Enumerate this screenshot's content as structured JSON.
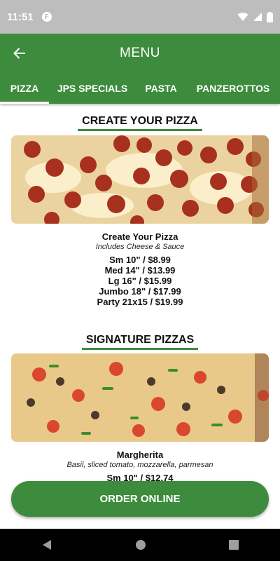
{
  "status": {
    "time": "11:51"
  },
  "header": {
    "title": "MENU"
  },
  "tabs": [
    {
      "label": "PIZZA"
    },
    {
      "label": "JPS SPECIALS"
    },
    {
      "label": "PASTA"
    },
    {
      "label": "PANZEROTTOS"
    }
  ],
  "sections": [
    {
      "title": "CREATE YOUR PIZZA",
      "item": {
        "name": "Create Your Pizza",
        "description": "Includes Cheese & Sauce",
        "prices": [
          "Sm 10\" / $8.99",
          "Med 14\" / $13.99",
          "Lg 16\" / $15.99",
          "Jumbo 18\" / $17.99",
          "Party 21x15 / $19.99"
        ]
      }
    },
    {
      "title": "SIGNATURE PIZZAS",
      "item": {
        "name": "Margherita",
        "description": "Basil, sliced tomato, mozzarella, parmesan",
        "prices": [
          "Sm 10\" / $12.74"
        ]
      }
    }
  ],
  "cta": {
    "label": "ORDER ONLINE"
  },
  "colors": {
    "primary": "#3d8b3d",
    "status_bar": "#bdbdbd"
  }
}
